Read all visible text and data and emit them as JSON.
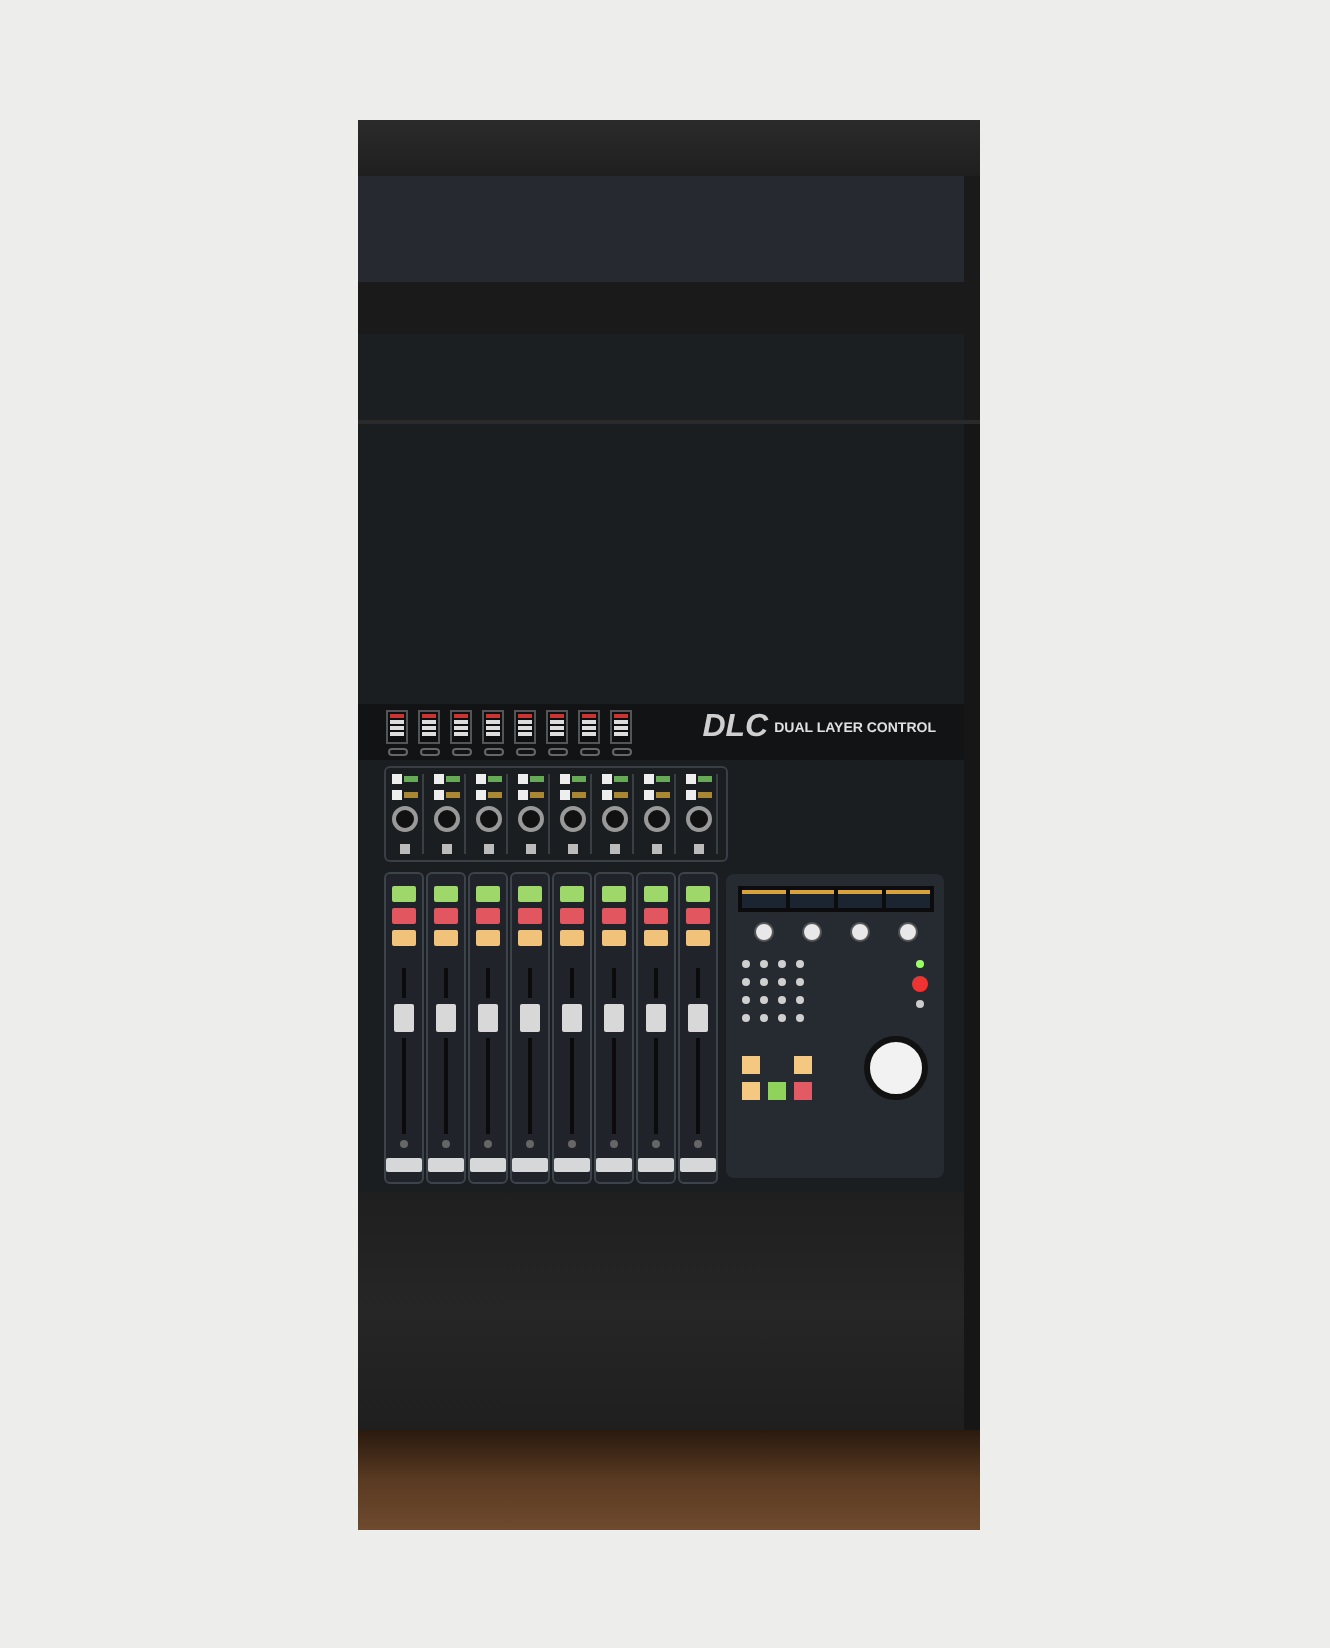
{
  "console": {
    "logo": "DLC",
    "logo_subtitle": "DUAL LAYER CONTROL"
  }
}
